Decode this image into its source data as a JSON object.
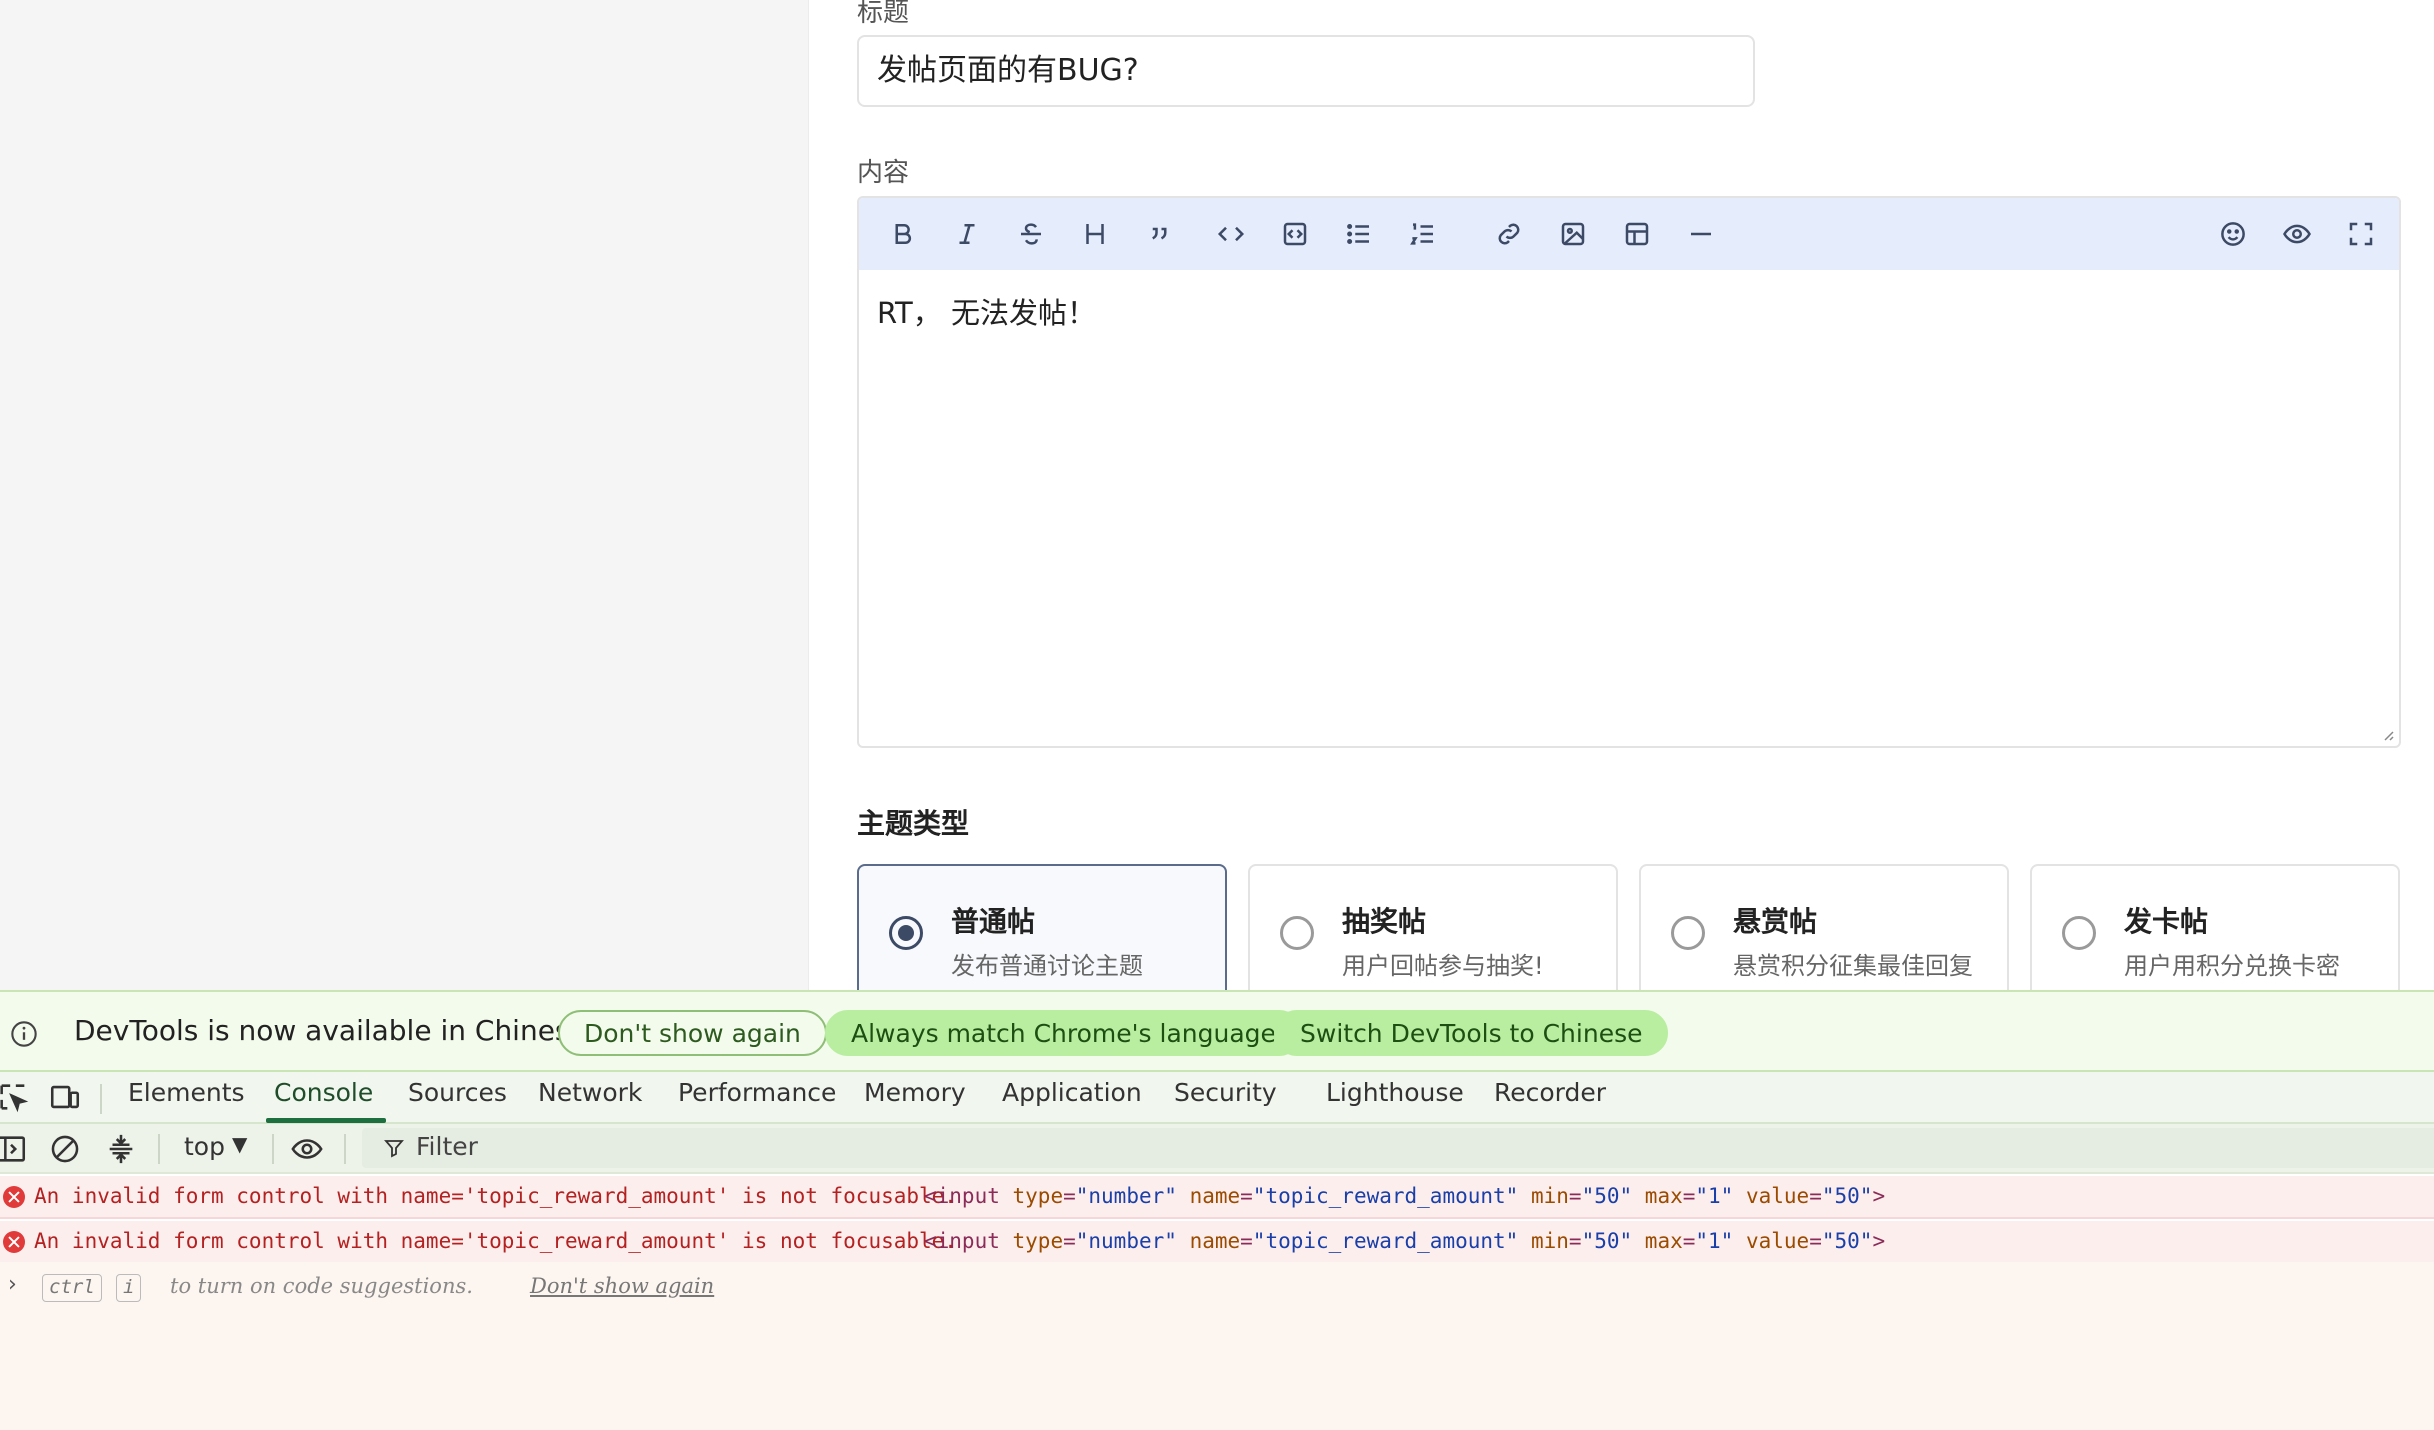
{
  "form": {
    "title_label": "标题",
    "title_value": "发帖页面的有BUG?",
    "content_label": "内容",
    "content_value": "RT， 无法发帖！",
    "toolbar_icons": [
      "bold-icon",
      "italic-icon",
      "strikethrough-icon",
      "heading-icon",
      "quote-icon",
      "code-icon",
      "code-block-icon",
      "bullet-list-icon",
      "ordered-list-icon",
      "link-icon",
      "image-icon",
      "table-icon",
      "horizontal-rule-icon",
      "emoji-icon",
      "preview-icon",
      "fullscreen-icon"
    ],
    "type_label": "主题类型",
    "types": [
      {
        "title": "普通帖",
        "desc": "发布普通讨论主题",
        "selected": true
      },
      {
        "title": "抽奖帖",
        "desc": "用户回帖参与抽奖!",
        "selected": false
      },
      {
        "title": "悬赏帖",
        "desc": "悬赏积分征集最佳回复",
        "selected": false
      },
      {
        "title": "发卡帖",
        "desc": "用户用积分兑换卡密",
        "selected": false
      }
    ]
  },
  "devtools": {
    "banner": {
      "text": "DevTools is now available in Chinese",
      "dont_show": "Don't show again",
      "always_match": "Always match Chrome's language",
      "switch": "Switch DevTools to Chinese"
    },
    "tabs": [
      "Elements",
      "Console",
      "Sources",
      "Network",
      "Performance",
      "Memory",
      "Application",
      "Security",
      "Lighthouse",
      "Recorder"
    ],
    "active_tab": "Console",
    "context": "top",
    "filter_placeholder": "Filter",
    "messages": [
      {
        "text": "An invalid form control with name='topic_reward_amount' is not focusable.",
        "tag_open": "<input",
        "attrs": [
          [
            "type",
            "\"number\""
          ],
          [
            "name",
            "\"topic_reward_amount\""
          ],
          [
            "min",
            "\"50\""
          ],
          [
            "max",
            "\"1\""
          ],
          [
            "value",
            "\"50\""
          ]
        ],
        "tag_close": ">"
      },
      {
        "text": "An invalid form control with name='topic_reward_amount' is not focusable.",
        "tag_open": "<input",
        "attrs": [
          [
            "type",
            "\"number\""
          ],
          [
            "name",
            "\"topic_reward_amount\""
          ],
          [
            "min",
            "\"50\""
          ],
          [
            "max",
            "\"1\""
          ],
          [
            "value",
            "\"50\""
          ]
        ],
        "tag_close": ">"
      }
    ],
    "prompt": {
      "key1": "ctrl",
      "key2": "i",
      "hint": "to turn on code suggestions.",
      "dont_show": "Don't show again"
    }
  }
}
